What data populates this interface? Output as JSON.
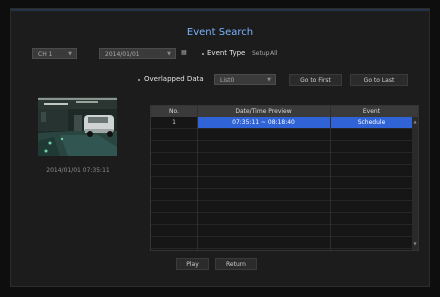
{
  "dialog": {
    "title": "Event Search"
  },
  "controls": {
    "channel": "CH 1",
    "date": "2014/01/01",
    "calendar_icon": "calendar-icon",
    "event_type_label": "Event Type",
    "setup_label": "Setup",
    "setup_value": "All",
    "overlapped_label": "Overlapped Data",
    "overlapped_value": "List0",
    "go_first": "Go to First",
    "go_last": "Go to Last"
  },
  "preview": {
    "timestamp": "2014/01/01 07:35:11"
  },
  "table": {
    "headers": [
      "No.",
      "Date/Time Preview",
      "Event"
    ],
    "rows": [
      {
        "no": "1",
        "time": "07:35:11 ~ 08:18:40",
        "event": "Schedule",
        "selected": true
      }
    ]
  },
  "footer": {
    "play": "Play",
    "return": "Return"
  },
  "colors": {
    "accent": "#7ab4ff",
    "selected_row": "#2f63d6",
    "background": "#1c1c1c"
  }
}
